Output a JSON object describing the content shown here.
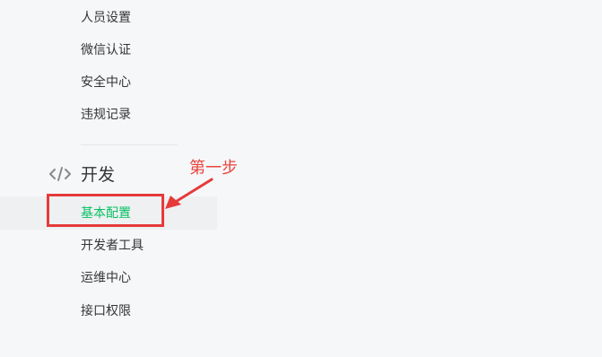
{
  "nav": {
    "items_above": [
      {
        "label": "人员设置"
      },
      {
        "label": "微信认证"
      },
      {
        "label": "安全中心"
      },
      {
        "label": "违规记录"
      }
    ],
    "section": {
      "title": "开发",
      "icon": "code-icon"
    },
    "dev_items": [
      {
        "label": "基本配置",
        "active": true
      },
      {
        "label": "开发者工具"
      },
      {
        "label": "运维中心"
      },
      {
        "label": "接口权限"
      }
    ]
  },
  "annotation": {
    "text": "第一步",
    "color": "#e8453c"
  },
  "colors": {
    "active": "#07c160",
    "text": "#353535",
    "background": "#f6f7f9"
  }
}
